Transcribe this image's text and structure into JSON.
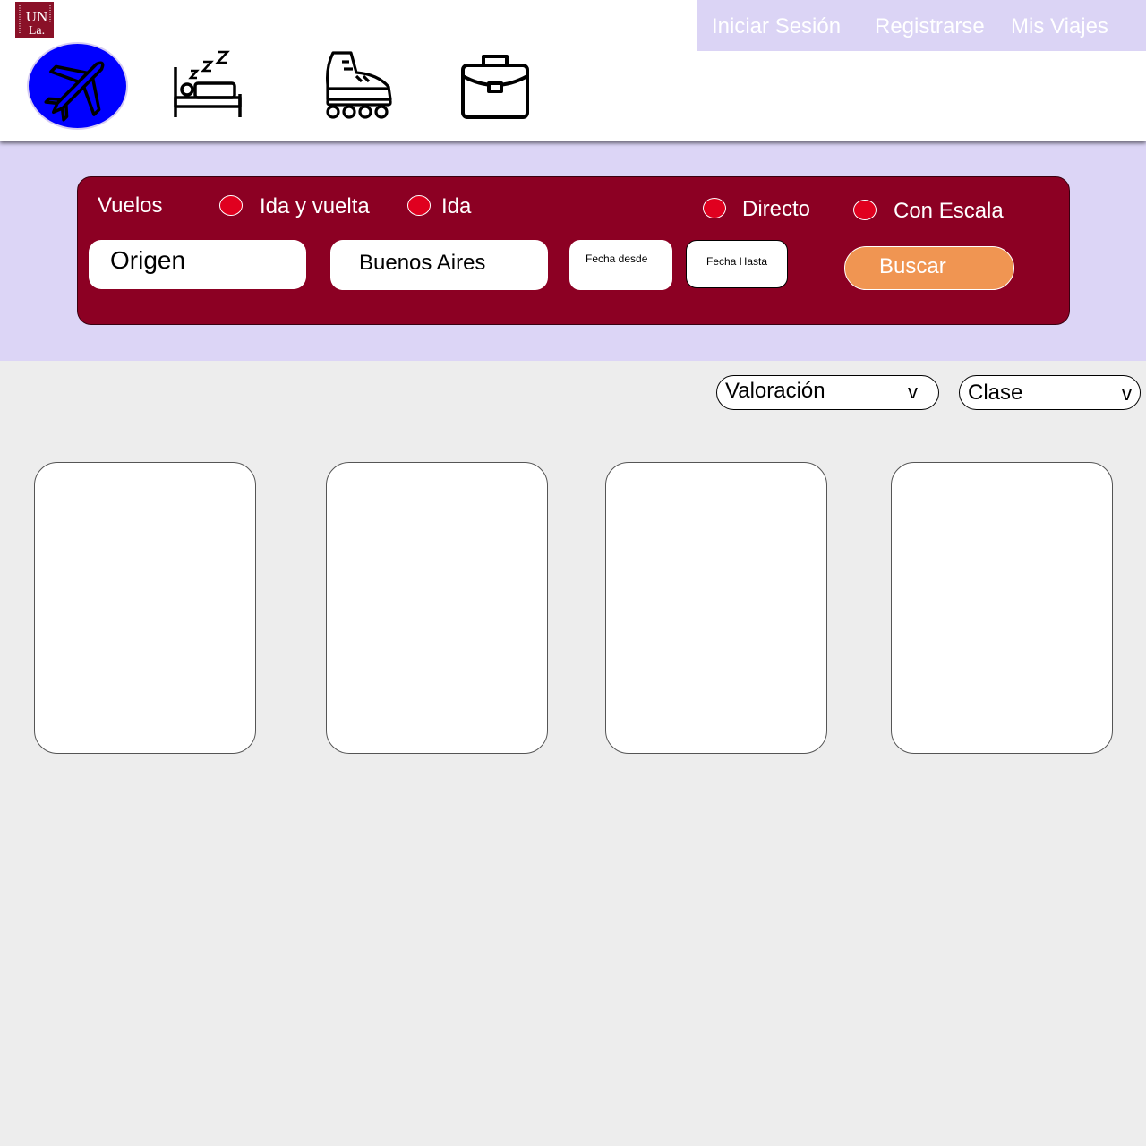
{
  "header": {
    "logo": {
      "text": "UNLa",
      "colors": {
        "background": "#8a1128"
      }
    },
    "nav": {
      "login_label": "Iniciar Sesión",
      "register_label": "Registrarse",
      "trips_label": "Mis Viajes",
      "background": "#dbd4f5"
    },
    "categories": [
      {
        "icon": "airplane-icon",
        "selected": true
      },
      {
        "icon": "sleeping-bed-icon",
        "selected": false
      },
      {
        "icon": "roller-skate-icon",
        "selected": false
      },
      {
        "icon": "briefcase-icon",
        "selected": false
      }
    ]
  },
  "search": {
    "section_label": "Vuelos",
    "trip_type": {
      "round_trip_label": "Ida y vuelta",
      "one_way_label": "Ida"
    },
    "stops": {
      "direct_label": "Directo",
      "layover_label": "Con Escala"
    },
    "origin": {
      "value": "Origen"
    },
    "destination": {
      "value": "Buenos Aires"
    },
    "date_from": {
      "value": "Fecha desde"
    },
    "date_to": {
      "value": "Fecha Hasta"
    },
    "submit_label": "Buscar",
    "colors": {
      "panel": "#8c0023",
      "radio": "#e0001f",
      "button": "#f09552",
      "hero": "#dcd5f6"
    }
  },
  "filters": {
    "rating": {
      "label": "Valoración",
      "chevron": "v"
    },
    "class": {
      "label": "Clase",
      "chevron": "v"
    }
  },
  "results": {
    "cards": [
      {},
      {},
      {},
      {}
    ]
  }
}
